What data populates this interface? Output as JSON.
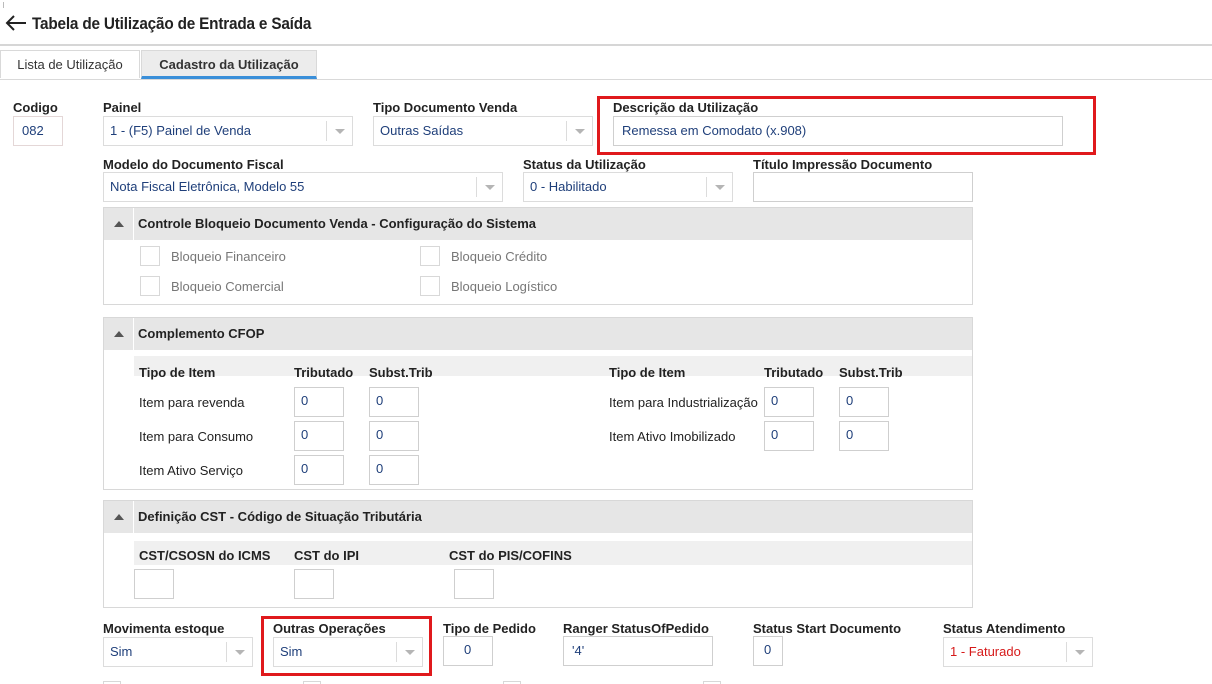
{
  "header": {
    "title": "Tabela de Utilização de Entrada e Saída",
    "back_icon": "arrow-left-icon"
  },
  "tabs": [
    {
      "label": "Lista de Utilização",
      "active": false
    },
    {
      "label": "Cadastro da Utilização",
      "active": true
    }
  ],
  "form": {
    "codigo": {
      "label": "Codigo",
      "value": "082"
    },
    "painel": {
      "label": "Painel",
      "value": "1 - (F5) Painel de Venda"
    },
    "tipo_documento_venda": {
      "label": "Tipo Documento Venda",
      "value": "Outras Saídas"
    },
    "descricao": {
      "label": "Descrição da Utilização",
      "value": "Remessa em Comodato (x.908)"
    },
    "modelo_documento": {
      "label": "Modelo do Documento Fiscal",
      "value": "Nota Fiscal Eletrônica, Modelo 55"
    },
    "status_utilizacao": {
      "label": "Status da Utilização",
      "value": "0 - Habilitado"
    },
    "titulo_impressao": {
      "label": "Título Impressão Documento",
      "value": ""
    }
  },
  "controle_bloqueio": {
    "title": "Controle Bloqueio Documento Venda - Configuração do Sistema",
    "items": [
      {
        "label": "Bloqueio Financeiro"
      },
      {
        "label": "Bloqueio Crédito"
      },
      {
        "label": "Bloqueio Comercial"
      },
      {
        "label": "Bloqueio Logístico"
      }
    ]
  },
  "complemento_cfop": {
    "title": "Complemento CFOP",
    "headers": {
      "tipo_item": "Tipo de Item",
      "tributado": "Tributado",
      "subst": "Subst.Trib"
    },
    "left_rows": [
      {
        "label": "Item para revenda",
        "tributado": "0",
        "subst": "0"
      },
      {
        "label": "Item para Consumo",
        "tributado": "0",
        "subst": "0"
      },
      {
        "label": "Item Ativo Serviço",
        "tributado": "0",
        "subst": "0"
      }
    ],
    "right_rows": [
      {
        "label": "Item para Industrialização",
        "tributado": "0",
        "subst": "0"
      },
      {
        "label": "Item Ativo Imobilizado",
        "tributado": "0",
        "subst": "0"
      }
    ]
  },
  "definicao_cst": {
    "title": "Definição CST - Código de Situação Tributária",
    "fields": [
      {
        "label": "CST/CSOSN do ICMS",
        "value": ""
      },
      {
        "label": "CST do IPI",
        "value": ""
      },
      {
        "label": "CST do PIS/COFINS",
        "value": ""
      }
    ]
  },
  "bottom": {
    "movimenta_estoque": {
      "label": "Movimenta estoque",
      "value": "Sim"
    },
    "outras_operacoes": {
      "label": "Outras Operações",
      "value": "Sim"
    },
    "tipo_pedido": {
      "label": "Tipo de Pedido",
      "value": "0"
    },
    "ranger_status": {
      "label": "Ranger StatusOfPedido",
      "value": "'4'"
    },
    "status_start": {
      "label": "Status Start Documento",
      "value": "0"
    },
    "status_atendimento": {
      "label": "Status Atendimento",
      "value": "1 - Faturado"
    }
  },
  "colors": {
    "highlight": "#e0191c",
    "value_text": "#1f3f7a",
    "status_red": "#d61a1a",
    "tab_accent": "#3a8fd9"
  }
}
